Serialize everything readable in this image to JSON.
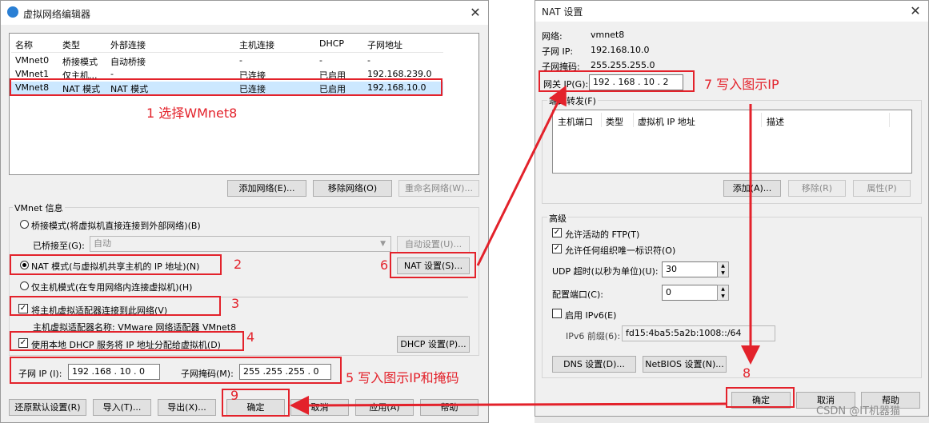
{
  "vne": {
    "title": "虚拟网络编辑器",
    "table": {
      "headers": [
        "名称",
        "类型",
        "外部连接",
        "主机连接",
        "DHCP",
        "子网地址"
      ],
      "rows": [
        [
          "VMnet0",
          "桥接模式",
          "自动桥接",
          "-",
          "-",
          "-"
        ],
        [
          "VMnet1",
          "仅主机...",
          "-",
          "已连接",
          "已启用",
          "192.168.239.0"
        ],
        [
          "VMnet8",
          "NAT 模式",
          "NAT 模式",
          "已连接",
          "已启用",
          "192.168.10.0"
        ]
      ]
    },
    "buttons": {
      "add_network": "添加网络(E)...",
      "remove_network": "移除网络(O)",
      "rename_network": "重命名网络(W)..."
    },
    "vmnet_info_label": "VMnet 信息",
    "bridge_mode": "桥接模式(将虚拟机直接连接到外部网络)(B)",
    "bridged_to_label": "已桥接至(G):",
    "bridged_to_value": "自动",
    "auto_settings": "自动设置(U)...",
    "nat_mode": "NAT 模式(与虚拟机共享主机的 IP 地址)(N)",
    "nat_settings": "NAT 设置(S)...",
    "host_only": "仅主机模式(在专用网络内连接虚拟机)(H)",
    "connect_adapter": "将主机虚拟适配器连接到此网络(V)",
    "adapter_name_label": "主机虚拟适配器名称: VMware 网络适配器 VMnet8",
    "use_dhcp": "使用本地 DHCP 服务将 IP 地址分配给虚拟机(D)",
    "dhcp_settings": "DHCP 设置(P)...",
    "subnet_ip_label": "子网 IP (I):",
    "subnet_ip": "192 .168 . 10 .  0",
    "subnet_mask_label": "子网掩码(M):",
    "subnet_mask": "255 .255 .255 .  0",
    "bottom_buttons": {
      "restore": "还原默认设置(R)",
      "import": "导入(T)...",
      "export": "导出(X)...",
      "ok": "确定",
      "cancel": "取消",
      "apply": "应用(A)",
      "help": "帮助"
    }
  },
  "nat": {
    "title": "NAT 设置",
    "network_label": "网络:",
    "network_value": "vmnet8",
    "subnet_ip_label": "子网 IP:",
    "subnet_ip_value": "192.168.10.0",
    "subnet_mask_label": "子网掩码:",
    "subnet_mask_value": "255.255.255.0",
    "gateway_label": "网关 IP(G):",
    "gateway_value": "192 . 168 . 10  .  2",
    "port_forward_label": "端口转发(F)",
    "pf_headers": [
      "主机端口",
      "类型",
      "虚拟机 IP 地址",
      "描述"
    ],
    "pf_buttons": {
      "add": "添加(A)...",
      "remove": "移除(R)",
      "properties": "属性(P)"
    },
    "advanced_label": "高级",
    "allow_ftp": "允许活动的 FTP(T)",
    "allow_uid": "允许任何组织唯一标识符(O)",
    "udp_timeout_label": "UDP 超时(以秒为单位)(U):",
    "udp_timeout_value": "30",
    "config_port_label": "配置端口(C):",
    "config_port_value": "0",
    "enable_ipv6": "启用 IPv6(E)",
    "ipv6_prefix_label": "IPv6 前缀(6):",
    "ipv6_prefix_value": "fd15:4ba5:5a2b:1008::/64",
    "dns_settings": "DNS 设置(D)...",
    "netbios_settings": "NetBIOS 设置(N)...",
    "ok": "确定",
    "cancel": "取消",
    "help": "帮助"
  },
  "annotations": {
    "a1": "1 选择WMnet8",
    "a2": "2",
    "a3": "3",
    "a4": "4",
    "a5": "5 写入图示IP和掩码",
    "a6": "6",
    "a7": "7 写入图示IP",
    "a8": "8",
    "a9": "9"
  },
  "watermark": "CSDN @IT机器猫",
  "colors": {
    "annotation_red": "#e3222b",
    "selected_row": "#cce8ff"
  }
}
